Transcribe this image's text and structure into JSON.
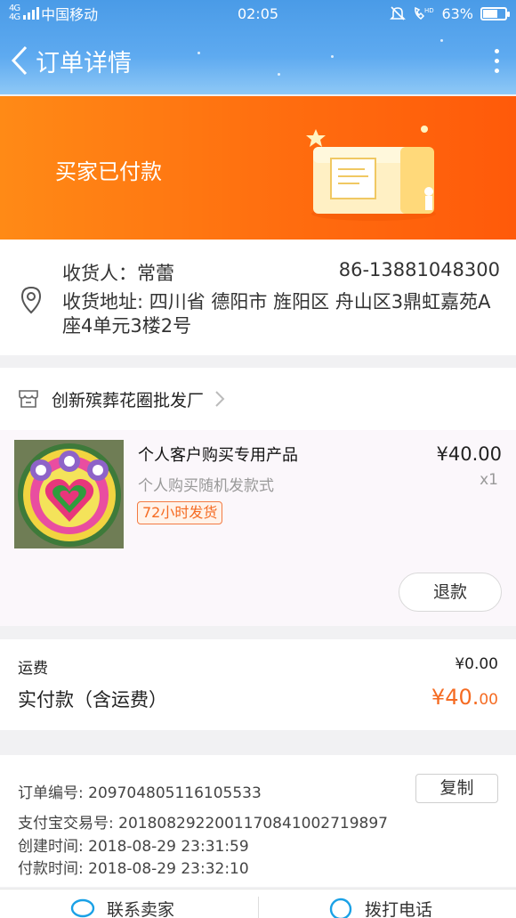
{
  "status_bar": {
    "signal": "4G 4G",
    "carrier": "中国移动",
    "time": "02:05",
    "battery": "63%",
    "battery_level": 0.63
  },
  "header": {
    "title": "订单详情"
  },
  "banner": {
    "status": "买家已付款"
  },
  "address": {
    "receiver": "收货人：常蕾",
    "phone": "86-13881048300",
    "full_address": "收货地址: 四川省 德阳市 旌阳区 舟山区3鼎虹嘉苑A座4单元3楼2号"
  },
  "shop": {
    "name": "创新殡葬花圈批发厂"
  },
  "product": {
    "title": "个人客户购买专用产品",
    "spec": "个人购买随机发款式",
    "tag": "72小时发货",
    "price": "¥40.00",
    "quantity": "x1",
    "refund_label": "退款"
  },
  "fees": {
    "shipping_label": "运费",
    "shipping_value": "¥0.00",
    "total_label": "实付款（含运费）",
    "total_main": "¥40.",
    "total_cents": "00"
  },
  "order_info": {
    "order_no": "订单编号:  209704805116105533",
    "copy_label": "复制",
    "alipay_no": "支付宝交易号:  2018082922001170841002719897",
    "created": "创建时间:  2018-08-29 23:31:59",
    "paid": "付款时间:  2018-08-29 23:32:10"
  },
  "bottom_bar": {
    "contact_label": "联系卖家",
    "call_label": "拨打电话"
  },
  "colors": {
    "accent_orange": "#f56b22",
    "header_blue": "#4a9be7"
  }
}
